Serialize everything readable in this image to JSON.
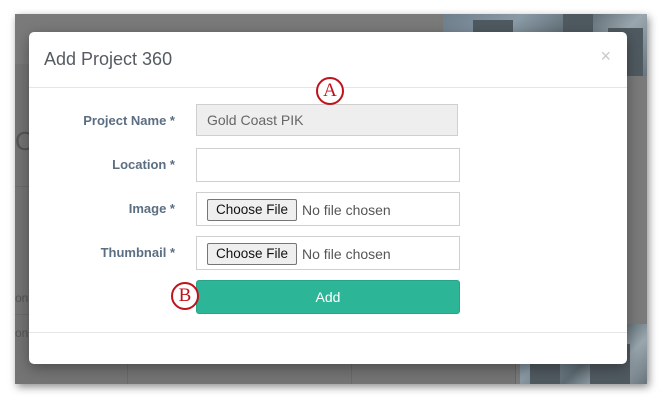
{
  "modal": {
    "title": "Add Project 360",
    "close_glyph": "×",
    "fields": {
      "project_name": {
        "label": "Project Name *",
        "value": "Gold Coast PIK"
      },
      "location": {
        "label": "Location *",
        "value": ""
      },
      "image": {
        "label": "Image *",
        "button": "Choose File",
        "status": "No file chosen"
      },
      "thumbnail": {
        "label": "Thumbnail *",
        "button": "Choose File",
        "status": "No file chosen"
      }
    },
    "submit_label": "Add"
  },
  "annotations": {
    "a": "A",
    "b": "B"
  },
  "colors": {
    "accent": "#2cb596",
    "marker": "#c0121c",
    "label": "#5b6e82"
  },
  "background": {
    "glyph_1": "O",
    "glyph_2": "on",
    "glyph_3": "on"
  }
}
